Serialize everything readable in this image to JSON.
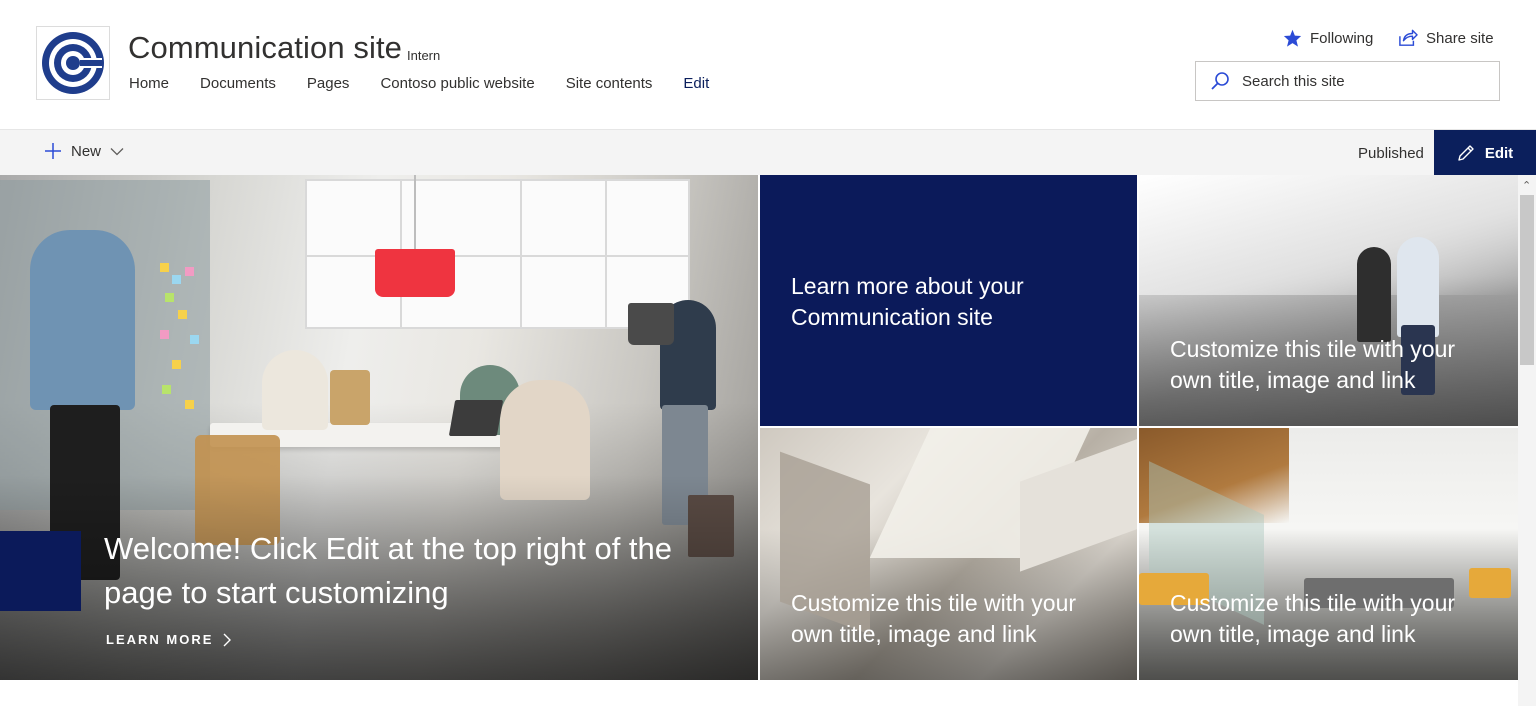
{
  "site": {
    "title": "Communication site",
    "badge": "Intern"
  },
  "nav": {
    "items": [
      "Home",
      "Documents",
      "Pages",
      "Contoso public website",
      "Site contents",
      "Edit"
    ]
  },
  "actions": {
    "following_label": "Following",
    "share_label": "Share site"
  },
  "search": {
    "placeholder": "Search this site"
  },
  "command_bar": {
    "new_label": "New",
    "status": "Published",
    "edit_label": "Edit"
  },
  "hero": {
    "main": {
      "title": "Welcome! Click Edit at the top right of the page to start customizing",
      "link_label": "LEARN MORE"
    },
    "tiles": [
      "Learn more about your Communication site",
      "Customize this tile with your own title, image and link",
      "Customize this tile with your own title, image and link",
      "Customize this tile with your own title, image and link"
    ]
  },
  "colors": {
    "brand": "#0b1a5a",
    "accent_lamp": "#ef3440"
  },
  "icons": {
    "logo": "communication-site-logo-icon",
    "following": "star-icon",
    "share": "share-icon",
    "search": "search-icon",
    "new": "plus-icon",
    "dropdown": "chevron-down-icon",
    "edit": "pencil-icon",
    "learn_more": "chevron-right-icon"
  }
}
